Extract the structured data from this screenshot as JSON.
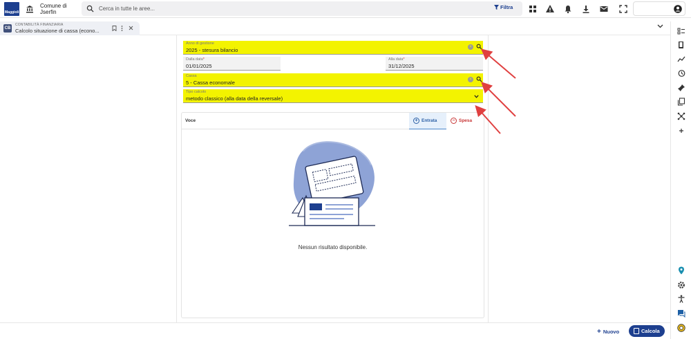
{
  "header": {
    "brand_text": "Maggioli",
    "comune_line1": "Comune di",
    "comune_line2": "Jserfin",
    "search_placeholder": "Cerca in tutte le aree...",
    "filter_label": "Filtra",
    "toolbar_icons": [
      "grid-icon",
      "warning-icon",
      "bell-icon",
      "download-icon",
      "mail-icon",
      "fullscreen-icon"
    ],
    "user_icon": "user-icon"
  },
  "tab": {
    "icon_text": "CB",
    "module": "CONTABILITÀ FINANZIARIA",
    "title": "Calcolo situazione di cassa (econo..."
  },
  "form": {
    "anno": {
      "label": "Anno di gestione",
      "value": "2025 - stesura bilancio"
    },
    "dalla_data": {
      "label": "Dalla data",
      "value": "01/01/2025"
    },
    "alla_data": {
      "label": "Alla data",
      "value": "31/12/2025"
    },
    "cassa": {
      "label": "Cassa",
      "value": "5 - Cassa economale"
    },
    "tipo_calcolo": {
      "label": "Tipo calcolo",
      "value": "metodo classico (alla data della reversale)"
    }
  },
  "table": {
    "col_voce": "Voce",
    "tab_entrata": "Entrata",
    "tab_spesa": "Spesa",
    "empty_message": "Nessun risultato disponibile."
  },
  "footer": {
    "nuovo_label": "Nuovo",
    "calcola_label": "Calcola"
  },
  "colors": {
    "highlight": "#f3f300",
    "primary": "#1d3f8f",
    "entrata": "#2b5fa5",
    "spesa": "#c83535",
    "annotation_arrow": "#e04040"
  },
  "right_rail_icons": [
    "list-icon",
    "book-icon",
    "trend-icon",
    "history-icon",
    "pin-icon",
    "copy-icon",
    "network-icon",
    "plus-icon",
    "location-icon",
    "settings-icon",
    "accessibility-icon",
    "chat-icon",
    "help-icon"
  ]
}
